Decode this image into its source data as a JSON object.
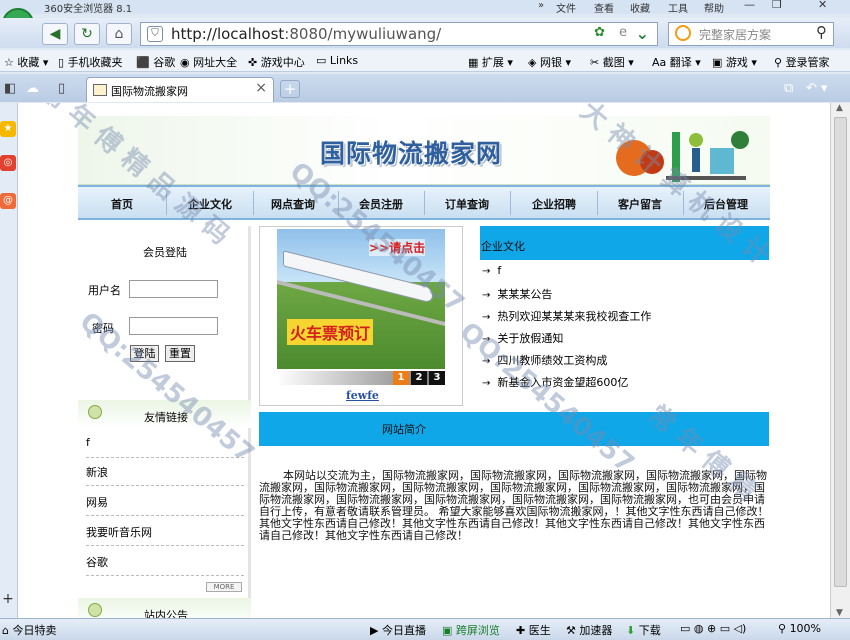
{
  "browser": {
    "title": "360安全浏览器 8.1",
    "menu": [
      "文件",
      "查看",
      "收藏",
      "工具",
      "帮助"
    ],
    "url_host": "http://localhost",
    "url_rest": ":8080/mywuliuwang/",
    "search_placeholder": "完整家居方案",
    "bookmarks": [
      "收藏",
      "手机收藏夹",
      "谷歌",
      "网址大全",
      "游戏中心",
      "Links",
      "扩展",
      "网银",
      "截图",
      "翻译",
      "游戏",
      "登录管家"
    ],
    "tab_title": "国际物流搬家网",
    "status": {
      "weather": "今日特卖",
      "live": "今日直播",
      "accelerate": "跨屏浏览",
      "doctor": "医生",
      "speeder": "加速器",
      "download": "下载",
      "zoom": "100%"
    }
  },
  "site": {
    "title": "国际物流搬家网",
    "nav": [
      "首页",
      "企业文化",
      "网点查询",
      "会员注册",
      "订单查询",
      "企业招聘",
      "客户留言",
      "后台管理"
    ],
    "login": {
      "title": "会员登陆",
      "username_label": "用户名",
      "password_label": "密码",
      "login_button": "登陆",
      "reset_button": "重置"
    },
    "friend_links": {
      "title": "友情链接",
      "items": [
        "f",
        "新浪",
        "网易",
        "我要听音乐网",
        "谷歌"
      ],
      "more": "MORE"
    },
    "notice_title": "站内公告",
    "slideshow": {
      "button_text": ">>请点击",
      "ticket_text": "火车票预订",
      "pages": [
        "1",
        "2",
        "3"
      ],
      "caption": "fewfe"
    },
    "culture": {
      "title": "企业文化",
      "items": [
        "f",
        "某某某公告",
        "热列欢迎某某某来我校视查工作",
        "关于放假通知",
        "四川教师绩效工资构成",
        "新基金入市资金望超600亿"
      ]
    },
    "intro": {
      "title": "网站简介",
      "text": "本网站以交流为主，国际物流搬家网，国际物流搬家网，国际物流搬家网，国际物流搬家网，国际物流搬家网，国际物流搬家网，国际物流搬家网，国际物流搬家网，国际物流搬家网，国际物流搬家网，国际物流搬家网，国际物流搬家网，国际物流搬家网，国际物流搬家网，国际物流搬家网，也可由会员申请自行上传，有意者敬请联系管理员。 希望大家能够喜欢国际物流搬家网，！其他文字性东西请自己修改！其他文字性东西请自己修改！其他文字性东西请自己修改！其他文字性东西请自己修改！其他文字性东西请自己修改！其他文字性东西请自己修改！"
    }
  },
  "colors": {
    "accent_blue": "#10a7e8",
    "title_blue": "#2f5f9e"
  }
}
